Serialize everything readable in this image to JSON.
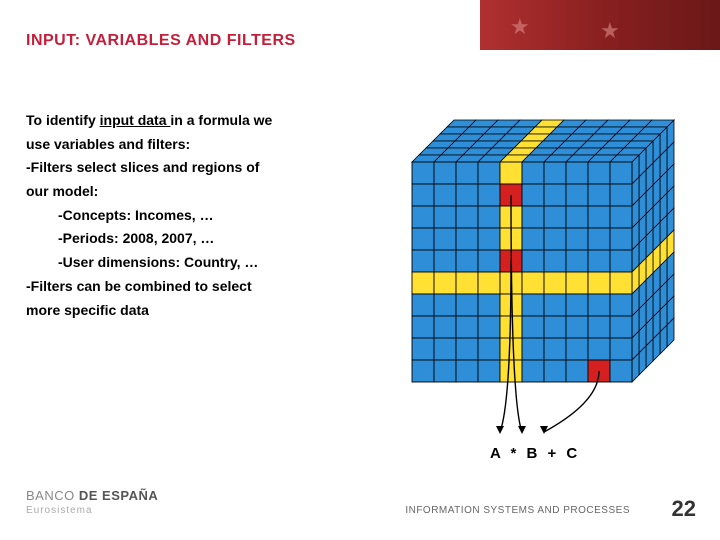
{
  "title": "INPUT: VARIABLES AND FILTERS",
  "body": {
    "l1a": "To identify ",
    "l1b": "input data ",
    "l1c": "in a formula we",
    "l2": "use variables and filters:",
    "l3": "-Filters select slices and regions of",
    "l4": "our model:",
    "l5": "-Concepts: Incomes, …",
    "l6": "-Periods: 2008, 2007, …",
    "l7": "-User dimensions: Country, …",
    "l8": "-Filters can be combined to select",
    "l9": "more specific data"
  },
  "formula": "A * B + C",
  "logo": {
    "a": "BANCO",
    "b": "DE",
    "c": "ESPAÑA",
    "sub": "Eurosistema"
  },
  "footer": "INFORMATION SYSTEMS AND PROCESSES",
  "page": "22",
  "cube": {
    "cols": 10,
    "rows": 10,
    "depth": 6,
    "cell": 22,
    "isoX": 7,
    "isoY": -7,
    "yellowRow": 5,
    "yellowCol": 4,
    "reds": [
      [
        4,
        4
      ],
      [
        4,
        1
      ],
      [
        8,
        9
      ]
    ]
  }
}
